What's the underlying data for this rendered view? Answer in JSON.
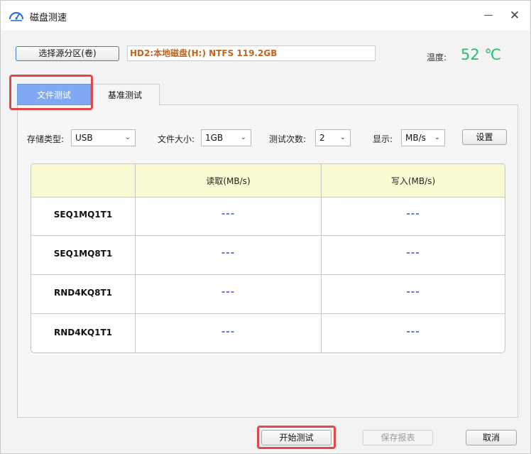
{
  "window": {
    "title": "磁盘测速",
    "close_symbol": "✕"
  },
  "source": {
    "button_label": "选择源分区(卷)",
    "disk_info": "HD2:本地磁盘(H:) NTFS 119.2GB"
  },
  "temperature": {
    "label": "温度:",
    "value": "52 ℃",
    "color": "#24c06c"
  },
  "tabs": [
    {
      "label": "文件测试",
      "active": true
    },
    {
      "label": "基准测试",
      "active": false
    }
  ],
  "options": {
    "storage_type": {
      "label": "存储类型:",
      "value": "USB"
    },
    "file_size": {
      "label": "文件大小:",
      "value": "1GB"
    },
    "test_count": {
      "label": "测试次数:",
      "value": "2"
    },
    "display": {
      "label": "显示:",
      "value": "MB/s"
    },
    "settings_label": "设置"
  },
  "table": {
    "headers": [
      "",
      "读取(MB/s)",
      "写入(MB/s)"
    ],
    "rows": [
      {
        "name": "SEQ1MQ1T1",
        "read": "---",
        "write": "---"
      },
      {
        "name": "SEQ1MQ8T1",
        "read": "---",
        "write": "---"
      },
      {
        "name": "RND4KQ8T1",
        "read": "---",
        "write": "---"
      },
      {
        "name": "RND4KQ1T1",
        "read": "---",
        "write": "---"
      }
    ]
  },
  "footer": {
    "start_label": "开始测试",
    "save_label": "保存报表",
    "cancel_label": "取消"
  },
  "icons": {
    "app": "speedometer-icon",
    "dropdown": "chevron-down-icon"
  }
}
